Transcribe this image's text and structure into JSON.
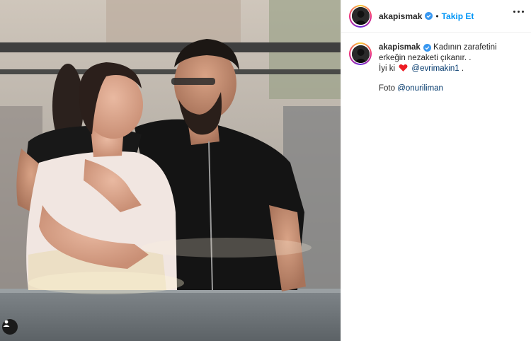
{
  "post": {
    "username": "akapismak",
    "separator": "•",
    "follow_label": "Takip Et",
    "caption": {
      "text_line1": "Kadının zarafetini",
      "text_line2": "erkeğin nezaketi çıkanır. .",
      "text_line3_prefix": "İyi ki",
      "mention1": "@evrimakin1",
      "text_line3_suffix": ".",
      "photo_prefix": "Foto",
      "mention2": "@onuriliman"
    }
  },
  "icons": {
    "verified": "verified-badge-icon",
    "more": "more-options-icon",
    "heart": "red-heart-emoji",
    "user_tag": "user-tag-icon"
  },
  "colors": {
    "link": "#0095f6",
    "mention": "#00376b",
    "verified": "#3897f0",
    "heart": "#ed1c24"
  }
}
